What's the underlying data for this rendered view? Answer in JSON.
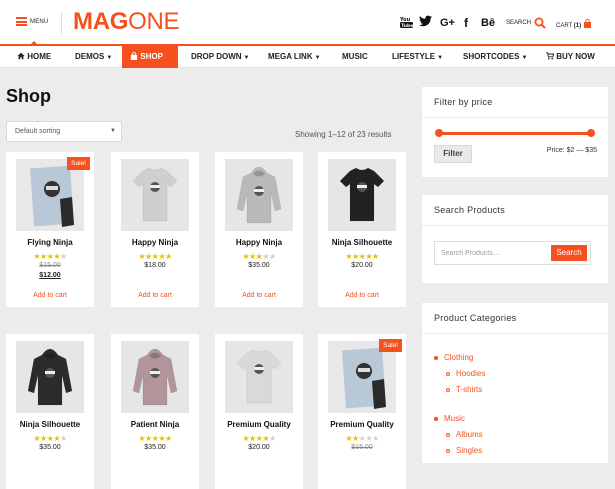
{
  "header": {
    "menu_label": "MENU",
    "logo_left": "MAG",
    "logo_right": "ONE",
    "search_label": "SEARCH",
    "cart_label": "CART",
    "cart_count": "(1)",
    "social": [
      "youtube-icon",
      "twitter-icon",
      "google-plus-icon",
      "facebook-icon",
      "behance-icon"
    ]
  },
  "nav": {
    "items": [
      {
        "label": "HOME",
        "icon": "home-icon"
      },
      {
        "label": "DEMOS"
      },
      {
        "label": "SHOP",
        "icon": "shopping-bag-icon"
      },
      {
        "label": "DROP DOWN"
      },
      {
        "label": "MEGA LINK"
      },
      {
        "label": "MUSIC"
      },
      {
        "label": "LIFESTYLE"
      },
      {
        "label": "SHORTCODES"
      },
      {
        "label": "BUY NOW",
        "icon": "cart-icon"
      }
    ]
  },
  "main": {
    "title": "Shop",
    "sort_value": "Default sorting",
    "results": "Showing 1–12 of 23 results",
    "add_to_cart": "Add to cart",
    "sale_badge": "Sale!",
    "products": [
      {
        "name": "Flying Ninja",
        "rating": 4,
        "old_price": "$15.00",
        "price": "$12.00",
        "sale": true,
        "kind": "poster"
      },
      {
        "name": "Happy Ninja",
        "rating": 5,
        "price": "$18.00",
        "sale": false,
        "kind": "tshirt",
        "shirt": "#cfcfcf"
      },
      {
        "name": "Happy Ninja",
        "rating": 3,
        "price": "$35.00",
        "sale": false,
        "kind": "hoodie",
        "shirt": "#b9b9b9"
      },
      {
        "name": "Ninja Silhouette",
        "rating": 5,
        "price": "$20.00",
        "sale": false,
        "kind": "tshirt",
        "shirt": "#222222"
      },
      {
        "name": "Ninja Silhouette",
        "rating": 4,
        "price": "$35.00",
        "sale": false,
        "kind": "hoodie",
        "shirt": "#2b2b2b"
      },
      {
        "name": "Patient Ninja",
        "rating": 5,
        "price": "$35.00",
        "sale": false,
        "kind": "hoodie",
        "shirt": "#b2949a"
      },
      {
        "name": "Premium Quality",
        "rating": 4.5,
        "price": "$20.00",
        "sale": false,
        "kind": "tshirt",
        "shirt": "#d9d9d9"
      },
      {
        "name": "Premium Quality",
        "rating": 2,
        "old_price": "$15.00",
        "sale": true,
        "kind": "poster"
      }
    ]
  },
  "sidebar": {
    "price_title": "Filter by price",
    "filter_button": "Filter",
    "price_range": "Price: $2 — $35",
    "search_title": "Search Products",
    "search_placeholder": "Search Products…",
    "search_button": "Search",
    "categories_title": "Product Categories",
    "categories": [
      {
        "label": "Clothing",
        "level": 0
      },
      {
        "label": "Hoodies",
        "level": 1
      },
      {
        "label": "T-shirts",
        "level": 1
      },
      {
        "label": "Music",
        "level": 0
      },
      {
        "label": "Albums",
        "level": 1
      },
      {
        "label": "Singles",
        "level": 1
      }
    ]
  },
  "colors": {
    "accent": "#f5511e",
    "star": "#e5c000",
    "background": "#ececec"
  }
}
